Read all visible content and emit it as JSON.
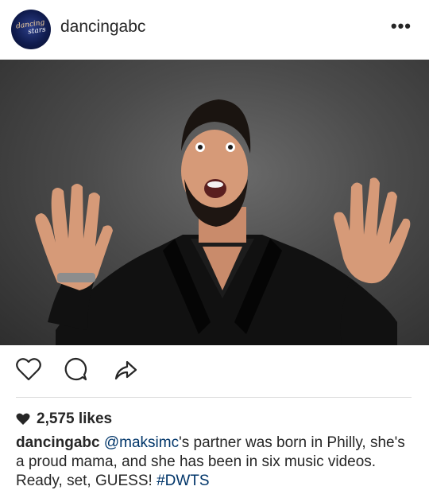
{
  "post": {
    "username": "dancingabc",
    "avatar_text": [
      "dancing",
      "stars"
    ],
    "more_icon": "more-horizontal-icon",
    "likes_text": "2,575 likes",
    "caption": {
      "username": "dancingabc",
      "mention": "@maksimc",
      "text_1": "'s partner was born in Philly, she's a proud mama, and she has been in six music videos. Ready, set, GUESS! ",
      "hashtag": "#DWTS"
    },
    "more_label": "•••"
  },
  "icons": [
    "heart-icon",
    "comment-icon",
    "share-icon"
  ],
  "colors": {
    "text": "#262626",
    "link": "#003569",
    "divider": "#dcdcdc"
  }
}
